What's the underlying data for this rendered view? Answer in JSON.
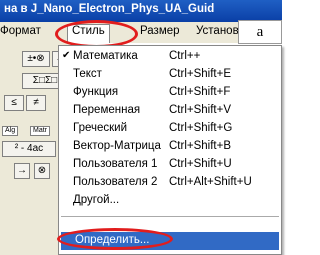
{
  "window": {
    "title": "на в J_Nano_Electron_Phys_UA_Guid"
  },
  "menubar": {
    "items": [
      {
        "id": "format",
        "label": "Формат"
      },
      {
        "id": "style",
        "label": "Стиль"
      },
      {
        "id": "size",
        "label": "Размер"
      },
      {
        "id": "settings",
        "label": "Установки"
      }
    ]
  },
  "panel_label": "a",
  "toolbar": {
    "row1": [
      "±•⊗",
      "→"
    ],
    "row2": [
      "Σ□Σ□"
    ],
    "row3": [
      "≤",
      "≠"
    ],
    "tabs": [
      "Alg",
      "Matr"
    ],
    "row4": [
      "² - 4ac"
    ],
    "row5": [
      "→",
      "⊗"
    ]
  },
  "dropdown": {
    "items": [
      {
        "label": "Математика",
        "shortcut": "Ctrl++",
        "checked": true
      },
      {
        "label": "Текст",
        "shortcut": "Ctrl+Shift+E",
        "checked": false
      },
      {
        "label": "Функция",
        "shortcut": "Ctrl+Shift+F",
        "checked": false
      },
      {
        "label": "Переменная",
        "shortcut": "Ctrl+Shift+V",
        "checked": false
      },
      {
        "label": "Греческий",
        "shortcut": "Ctrl+Shift+G",
        "checked": false
      },
      {
        "label": "Вектор-Матрица",
        "shortcut": "Ctrl+Shift+B",
        "checked": false
      },
      {
        "label": "Пользователя 1",
        "shortcut": "Ctrl+Shift+U",
        "checked": false
      },
      {
        "label": "Пользователя 2",
        "shortcut": "Ctrl+Alt+Shift+U",
        "checked": false
      },
      {
        "label": "Другой...",
        "shortcut": "",
        "checked": false
      }
    ],
    "define": {
      "label": "Определить..."
    }
  },
  "colors": {
    "titlebar": "#0a3fa6",
    "menu_bg": "#ece9d8",
    "highlight": "#316ac5",
    "annotation_ring": "#e11d1d"
  }
}
